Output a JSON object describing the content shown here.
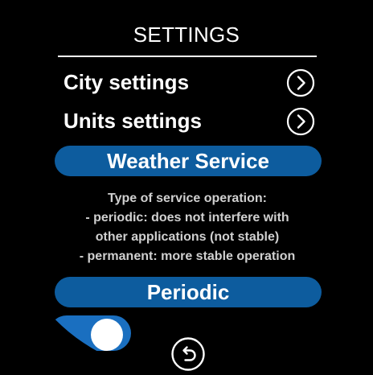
{
  "header": {
    "title": "SETTINGS"
  },
  "menu": {
    "items": [
      {
        "label": "City settings",
        "icon": "chevron-right-circle-icon"
      },
      {
        "label": "Units settings",
        "icon": "chevron-right-circle-icon"
      }
    ]
  },
  "weather_service": {
    "heading": "Weather Service",
    "description": [
      "Type of service operation:",
      "- periodic: does not interfere with",
      "other applications (not stable)",
      "- permanent: more stable operation"
    ],
    "mode_label": "Periodic",
    "toggle_on": true
  },
  "footer": {
    "back_icon": "back-arrow-icon"
  },
  "colors": {
    "background": "#000000",
    "accent": "#0d5c9e",
    "toggle": "#1a6fc0",
    "text": "#ffffff",
    "muted_text": "#d0d0d0"
  }
}
